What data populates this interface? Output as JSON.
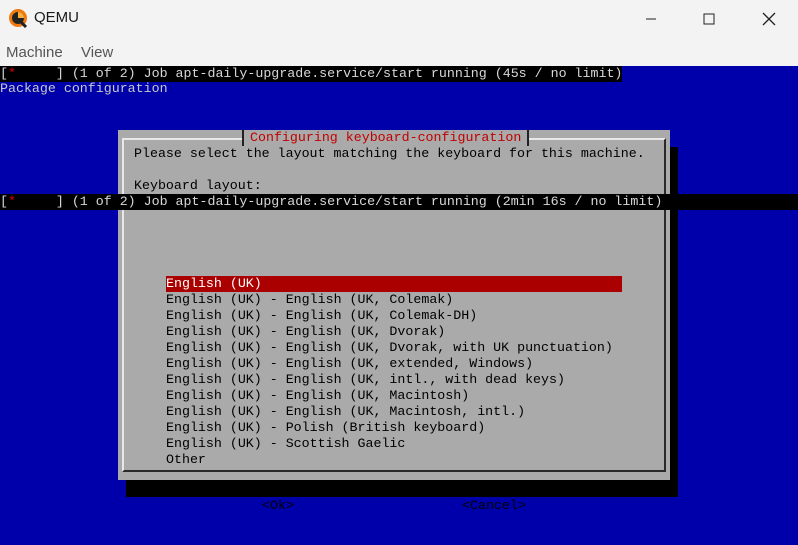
{
  "window": {
    "title": "QEMU"
  },
  "menu": {
    "items": [
      "Machine",
      "View"
    ]
  },
  "console": {
    "status_top": {
      "open": "[",
      "star": "*",
      "text": "     ] (1 of 2) Job apt-daily-upgrade.service/start running (45s / no limit)"
    },
    "status_mid": {
      "open": "[",
      "star": "*",
      "text": "     ] (1 of 2) Job apt-daily-upgrade.service/start running (2min 16s / no limit)"
    },
    "package_config": "Package configuration"
  },
  "dialog": {
    "title": "Configuring keyboard-configuration",
    "prompt": "Please select the layout matching the keyboard for this machine.",
    "layout_label": "Keyboard layout:",
    "options": [
      "English (UK)",
      "English (UK) - English (UK, Colemak)",
      "English (UK) - English (UK, Colemak-DH)",
      "English (UK) - English (UK, Dvorak)",
      "English (UK) - English (UK, Dvorak, with UK punctuation)",
      "English (UK) - English (UK, extended, Windows)",
      "English (UK) - English (UK, intl., with dead keys)",
      "English (UK) - English (UK, Macintosh)",
      "English (UK) - English (UK, Macintosh, intl.)",
      "English (UK) - Polish (British keyboard)",
      "English (UK) - Scottish Gaelic",
      "Other"
    ],
    "selected_index": 0,
    "ok_label": "<Ok>",
    "cancel_label": "<Cancel>"
  },
  "colors": {
    "console_bg": "#0000aa",
    "dialog_bg": "#aaaaaa",
    "selection": "#aa0000",
    "title_red": "#c00000"
  }
}
